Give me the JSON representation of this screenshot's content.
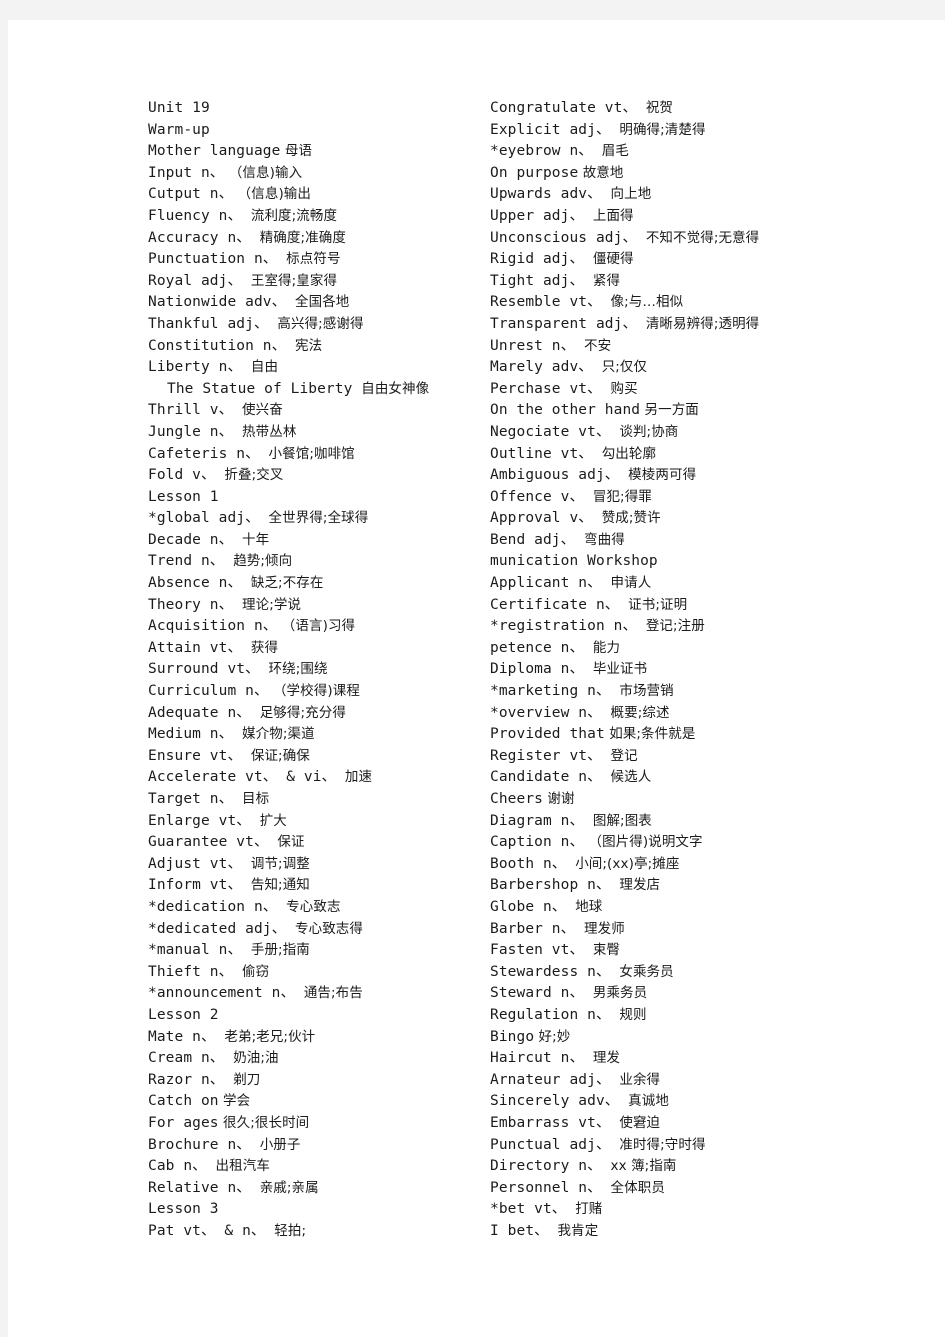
{
  "document": {
    "title": "Unit 19",
    "page_background": "#ffffff",
    "viewer_background": "#f3f3f3",
    "text_color": "#1b1b1b"
  },
  "columns": {
    "left": {
      "name": "left-column",
      "entries": [
        {
          "term": "Unit 19",
          "gloss": "",
          "indent": false
        },
        {
          "term": "Warm-up",
          "gloss": "",
          "indent": false
        },
        {
          "term": "Mother language",
          "gloss": " 母语",
          "indent": false
        },
        {
          "term": "Input n、",
          "gloss": " （信息)输入",
          "indent": false
        },
        {
          "term": "Cutput n、",
          "gloss": " （信息)输出",
          "indent": false
        },
        {
          "term": "Fluency n、",
          "gloss": "  流利度;流畅度",
          "indent": false
        },
        {
          "term": "Accuracy n、",
          "gloss": "  精确度;准确度",
          "indent": false
        },
        {
          "term": "Punctuation n、",
          "gloss": "  标点符号",
          "indent": false
        },
        {
          "term": "Royal adj、",
          "gloss": "  王室得;皇家得",
          "indent": false
        },
        {
          "term": "Nationwide adv、",
          "gloss": "  全国各地",
          "indent": false
        },
        {
          "term": "Thankful adj、",
          "gloss": "  高兴得;感谢得",
          "indent": false
        },
        {
          "term": "Constitution n、",
          "gloss": "  宪法",
          "indent": false
        },
        {
          "term": "Liberty n、",
          "gloss": "  自由",
          "indent": false
        },
        {
          "term": "The Statue of Liberty",
          "gloss": "  自由女神像",
          "indent": true
        },
        {
          "term": "Thrill v、",
          "gloss": "  使兴奋",
          "indent": false
        },
        {
          "term": "Jungle n、",
          "gloss": "  热带丛林",
          "indent": false
        },
        {
          "term": "Cafeteris n、",
          "gloss": "  小餐馆;咖啡馆",
          "indent": false
        },
        {
          "term": "Fold v、",
          "gloss": "  折叠;交叉",
          "indent": false
        },
        {
          "term": "Lesson 1",
          "gloss": "",
          "indent": false
        },
        {
          "term": "*global adj、",
          "gloss": "  全世界得;全球得",
          "indent": false
        },
        {
          "term": "Decade n、",
          "gloss": "  十年",
          "indent": false
        },
        {
          "term": "Trend n、",
          "gloss": "  趋势;倾向",
          "indent": false
        },
        {
          "term": "Absence n、",
          "gloss": "  缺乏;不存在",
          "indent": false
        },
        {
          "term": "Theory n、",
          "gloss": "  理论;学说",
          "indent": false
        },
        {
          "term": "Acquisition n、",
          "gloss": " （语言)习得",
          "indent": false
        },
        {
          "term": "Attain vt、",
          "gloss": "  获得",
          "indent": false
        },
        {
          "term": "Surround vt、",
          "gloss": "  环绕;围绕",
          "indent": false
        },
        {
          "term": "Curriculum n、",
          "gloss": " （学校得)课程",
          "indent": false
        },
        {
          "term": "Adequate n、",
          "gloss": "  足够得;充分得",
          "indent": false
        },
        {
          "term": "Medium n、",
          "gloss": "  媒介物;渠道",
          "indent": false
        },
        {
          "term": "Ensure vt、",
          "gloss": "  保证;确保",
          "indent": false
        },
        {
          "term": "Accelerate vt、 & vi、",
          "gloss": "  加速",
          "indent": false
        },
        {
          "term": "Target n、",
          "gloss": "  目标",
          "indent": false
        },
        {
          "term": "Enlarge vt、",
          "gloss": "  扩大",
          "indent": false
        },
        {
          "term": "Guarantee vt、",
          "gloss": "  保证",
          "indent": false
        },
        {
          "term": "Adjust vt、",
          "gloss": "  调节;调整",
          "indent": false
        },
        {
          "term": "Inform vt、",
          "gloss": "  告知;通知",
          "indent": false
        },
        {
          "term": "*dedication n、",
          "gloss": "  专心致志",
          "indent": false
        },
        {
          "term": "*dedicated adj、",
          "gloss": "  专心致志得",
          "indent": false
        },
        {
          "term": "*manual n、",
          "gloss": "  手册;指南",
          "indent": false
        },
        {
          "term": "Thieft n、",
          "gloss": "  偷窃",
          "indent": false
        },
        {
          "term": "*announcement n、",
          "gloss": "  通告;布告",
          "indent": false
        },
        {
          "term": "Lesson 2",
          "gloss": "",
          "indent": false
        },
        {
          "term": "Mate n、",
          "gloss": "  老弟;老兄;伙计",
          "indent": false
        },
        {
          "term": "Cream n、",
          "gloss": "  奶油;油",
          "indent": false
        },
        {
          "term": "Razor n、",
          "gloss": "  剃刀",
          "indent": false
        },
        {
          "term": "Catch on",
          "gloss": " 学会",
          "indent": false
        },
        {
          "term": "For ages",
          "gloss": " 很久;很长时间",
          "indent": false
        },
        {
          "term": "Brochure n、",
          "gloss": "  小册子",
          "indent": false
        },
        {
          "term": "Cab n、",
          "gloss": "  出租汽车",
          "indent": false
        },
        {
          "term": "Relative n、",
          "gloss": "  亲戚;亲属",
          "indent": false
        },
        {
          "term": "Lesson 3",
          "gloss": "",
          "indent": false
        },
        {
          "term": "Pat vt、 & n、",
          "gloss": "  轻拍;",
          "indent": false
        }
      ]
    },
    "right": {
      "name": "right-column",
      "entries": [
        {
          "term": "Congratulate vt、",
          "gloss": "  祝贺",
          "indent": false
        },
        {
          "term": "Explicit adj、",
          "gloss": "  明确得;清楚得",
          "indent": false
        },
        {
          "term": "*eyebrow n、",
          "gloss": "  眉毛",
          "indent": false
        },
        {
          "term": "On purpose",
          "gloss": " 故意地",
          "indent": false
        },
        {
          "term": "Upwards adv、",
          "gloss": "  向上地",
          "indent": false
        },
        {
          "term": "Upper adj、",
          "gloss": "  上面得",
          "indent": false
        },
        {
          "term": "Unconscious adj、",
          "gloss": "  不知不觉得;无意得",
          "indent": false
        },
        {
          "term": "Rigid adj、",
          "gloss": "  僵硬得",
          "indent": false
        },
        {
          "term": "Tight adj、",
          "gloss": "  紧得",
          "indent": false
        },
        {
          "term": "Resemble vt、",
          "gloss": "  像;与…相似",
          "indent": false
        },
        {
          "term": "Transparent adj、",
          "gloss": "  清晰易辨得;透明得",
          "indent": false
        },
        {
          "term": "Unrest n、",
          "gloss": "  不安",
          "indent": false
        },
        {
          "term": "Marely adv、",
          "gloss": "  只;仅仅",
          "indent": false
        },
        {
          "term": "Perchase vt、",
          "gloss": "  购买",
          "indent": false
        },
        {
          "term": "On the other hand",
          "gloss": " 另一方面",
          "indent": false
        },
        {
          "term": "Negociate vt、",
          "gloss": "  谈判;协商",
          "indent": false
        },
        {
          "term": "Outline vt、",
          "gloss": "  勾出轮廓",
          "indent": false
        },
        {
          "term": "Ambiguous adj、",
          "gloss": "  模棱两可得",
          "indent": false
        },
        {
          "term": "Offence v、",
          "gloss": "  冒犯;得罪",
          "indent": false
        },
        {
          "term": "Approval v、",
          "gloss": "  赞成;赞许",
          "indent": false
        },
        {
          "term": "Bend adj、",
          "gloss": "  弯曲得",
          "indent": false
        },
        {
          "term": "munication Workshop",
          "gloss": "",
          "indent": false
        },
        {
          "term": "Applicant n、",
          "gloss": "  申请人",
          "indent": false
        },
        {
          "term": "Certificate n、",
          "gloss": "  证书;证明",
          "indent": false
        },
        {
          "term": "*registration n、",
          "gloss": "  登记;注册",
          "indent": false
        },
        {
          "term": "petence n、",
          "gloss": "  能力",
          "indent": false
        },
        {
          "term": "Diploma n、",
          "gloss": "  毕业证书",
          "indent": false
        },
        {
          "term": "*marketing n、",
          "gloss": "  市场营销",
          "indent": false
        },
        {
          "term": "*overview n、",
          "gloss": "  概要;综述",
          "indent": false
        },
        {
          "term": "Provided that",
          "gloss": " 如果;条件就是",
          "indent": false
        },
        {
          "term": "Register vt、",
          "gloss": "  登记",
          "indent": false
        },
        {
          "term": "Candidate n、",
          "gloss": "  候选人",
          "indent": false
        },
        {
          "term": "Cheers",
          "gloss": " 谢谢",
          "indent": false
        },
        {
          "term": "Diagram n、",
          "gloss": "  图解;图表",
          "indent": false
        },
        {
          "term": "Caption n、",
          "gloss": " （图片得)说明文字",
          "indent": false
        },
        {
          "term": "Booth n、",
          "gloss": "  小间;(xx)亭;摊座",
          "indent": false
        },
        {
          "term": "Barbershop n、",
          "gloss": "  理发店",
          "indent": false
        },
        {
          "term": "Globe n、",
          "gloss": "  地球",
          "indent": false
        },
        {
          "term": "Barber n、",
          "gloss": "  理发师",
          "indent": false
        },
        {
          "term": "Fasten vt、",
          "gloss": "  束臀",
          "indent": false
        },
        {
          "term": "Stewardess n、",
          "gloss": "  女乘务员",
          "indent": false
        },
        {
          "term": "Steward n、",
          "gloss": "  男乘务员",
          "indent": false
        },
        {
          "term": "Regulation n、",
          "gloss": "  规则",
          "indent": false
        },
        {
          "term": "Bingo",
          "gloss": " 好;妙",
          "indent": false
        },
        {
          "term": "Haircut n、",
          "gloss": "  理发",
          "indent": false
        },
        {
          "term": "Arnateur adj、",
          "gloss": "  业余得",
          "indent": false
        },
        {
          "term": "Sincerely adv、",
          "gloss": "  真诚地",
          "indent": false
        },
        {
          "term": "Embarrass vt、",
          "gloss": "  使窘迫",
          "indent": false
        },
        {
          "term": "Punctual adj、",
          "gloss": "  准时得;守时得",
          "indent": false
        },
        {
          "term": "Directory n、",
          "gloss": "  xx 簿;指南",
          "indent": false
        },
        {
          "term": "Personnel n、",
          "gloss": "  全体职员",
          "indent": false
        },
        {
          "term": "*bet vt、",
          "gloss": "  打赌",
          "indent": false
        },
        {
          "term": "I bet、",
          "gloss": "  我肯定",
          "indent": false
        }
      ]
    }
  }
}
